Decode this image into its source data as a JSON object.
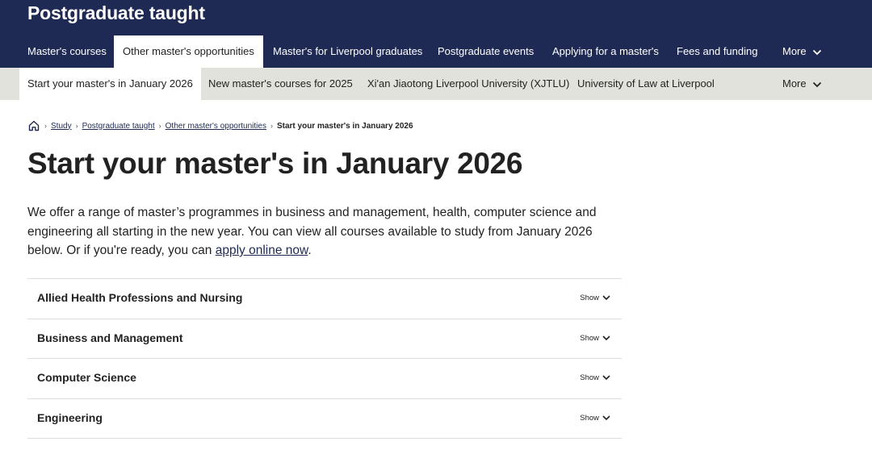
{
  "header": {
    "title": "Postgraduate taught"
  },
  "primary_nav": {
    "items": [
      {
        "label": "Master's courses"
      },
      {
        "label": "Other master's opportunities"
      },
      {
        "label": "Master's for Liverpool graduates"
      },
      {
        "label": "Postgraduate events"
      },
      {
        "label": "Applying for a master's"
      },
      {
        "label": "Fees and funding"
      }
    ],
    "more_label": "More"
  },
  "secondary_nav": {
    "items": [
      {
        "label": "Start your master's in January 2026"
      },
      {
        "label": "New master's courses for 2025"
      },
      {
        "label": "Xi'an Jiaotong Liverpool University (XJTLU)"
      },
      {
        "label": "University of Law at Liverpool"
      }
    ],
    "more_label": "More"
  },
  "breadcrumb": {
    "home_icon": "home-icon",
    "links": [
      "Study",
      "Postgraduate taught",
      "Other master's opportunities"
    ],
    "current": "Start your master's in January 2026"
  },
  "page": {
    "title": "Start your master's in January 2026",
    "intro_text": "We offer a range of master’s programmes in business and management, health, computer science and engineering all starting in the new year. You can view all courses available to study from January 2026 below. Or if you're ready, you can ",
    "intro_link": "apply online now",
    "intro_end": "."
  },
  "accordion": {
    "toggle_label": "Show",
    "sections": [
      {
        "title": "Allied Health Professions and Nursing"
      },
      {
        "title": "Business and Management"
      },
      {
        "title": "Computer Science"
      },
      {
        "title": "Engineering"
      }
    ]
  },
  "colors": {
    "navy": "#1f2a54",
    "subnav_bg": "#e2e2dc"
  }
}
